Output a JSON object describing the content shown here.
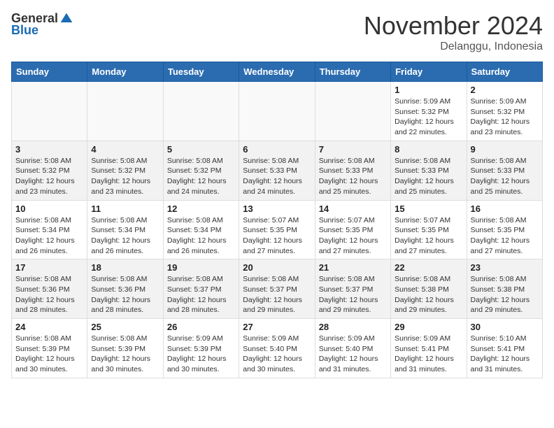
{
  "header": {
    "logo_general": "General",
    "logo_blue": "Blue",
    "month_title": "November 2024",
    "location": "Delanggu, Indonesia"
  },
  "weekdays": [
    "Sunday",
    "Monday",
    "Tuesday",
    "Wednesday",
    "Thursday",
    "Friday",
    "Saturday"
  ],
  "weeks": [
    [
      {
        "day": "",
        "info": ""
      },
      {
        "day": "",
        "info": ""
      },
      {
        "day": "",
        "info": ""
      },
      {
        "day": "",
        "info": ""
      },
      {
        "day": "",
        "info": ""
      },
      {
        "day": "1",
        "info": "Sunrise: 5:09 AM\nSunset: 5:32 PM\nDaylight: 12 hours\nand 22 minutes."
      },
      {
        "day": "2",
        "info": "Sunrise: 5:09 AM\nSunset: 5:32 PM\nDaylight: 12 hours\nand 23 minutes."
      }
    ],
    [
      {
        "day": "3",
        "info": "Sunrise: 5:08 AM\nSunset: 5:32 PM\nDaylight: 12 hours\nand 23 minutes."
      },
      {
        "day": "4",
        "info": "Sunrise: 5:08 AM\nSunset: 5:32 PM\nDaylight: 12 hours\nand 23 minutes."
      },
      {
        "day": "5",
        "info": "Sunrise: 5:08 AM\nSunset: 5:32 PM\nDaylight: 12 hours\nand 24 minutes."
      },
      {
        "day": "6",
        "info": "Sunrise: 5:08 AM\nSunset: 5:33 PM\nDaylight: 12 hours\nand 24 minutes."
      },
      {
        "day": "7",
        "info": "Sunrise: 5:08 AM\nSunset: 5:33 PM\nDaylight: 12 hours\nand 25 minutes."
      },
      {
        "day": "8",
        "info": "Sunrise: 5:08 AM\nSunset: 5:33 PM\nDaylight: 12 hours\nand 25 minutes."
      },
      {
        "day": "9",
        "info": "Sunrise: 5:08 AM\nSunset: 5:33 PM\nDaylight: 12 hours\nand 25 minutes."
      }
    ],
    [
      {
        "day": "10",
        "info": "Sunrise: 5:08 AM\nSunset: 5:34 PM\nDaylight: 12 hours\nand 26 minutes."
      },
      {
        "day": "11",
        "info": "Sunrise: 5:08 AM\nSunset: 5:34 PM\nDaylight: 12 hours\nand 26 minutes."
      },
      {
        "day": "12",
        "info": "Sunrise: 5:08 AM\nSunset: 5:34 PM\nDaylight: 12 hours\nand 26 minutes."
      },
      {
        "day": "13",
        "info": "Sunrise: 5:07 AM\nSunset: 5:35 PM\nDaylight: 12 hours\nand 27 minutes."
      },
      {
        "day": "14",
        "info": "Sunrise: 5:07 AM\nSunset: 5:35 PM\nDaylight: 12 hours\nand 27 minutes."
      },
      {
        "day": "15",
        "info": "Sunrise: 5:07 AM\nSunset: 5:35 PM\nDaylight: 12 hours\nand 27 minutes."
      },
      {
        "day": "16",
        "info": "Sunrise: 5:08 AM\nSunset: 5:35 PM\nDaylight: 12 hours\nand 27 minutes."
      }
    ],
    [
      {
        "day": "17",
        "info": "Sunrise: 5:08 AM\nSunset: 5:36 PM\nDaylight: 12 hours\nand 28 minutes."
      },
      {
        "day": "18",
        "info": "Sunrise: 5:08 AM\nSunset: 5:36 PM\nDaylight: 12 hours\nand 28 minutes."
      },
      {
        "day": "19",
        "info": "Sunrise: 5:08 AM\nSunset: 5:37 PM\nDaylight: 12 hours\nand 28 minutes."
      },
      {
        "day": "20",
        "info": "Sunrise: 5:08 AM\nSunset: 5:37 PM\nDaylight: 12 hours\nand 29 minutes."
      },
      {
        "day": "21",
        "info": "Sunrise: 5:08 AM\nSunset: 5:37 PM\nDaylight: 12 hours\nand 29 minutes."
      },
      {
        "day": "22",
        "info": "Sunrise: 5:08 AM\nSunset: 5:38 PM\nDaylight: 12 hours\nand 29 minutes."
      },
      {
        "day": "23",
        "info": "Sunrise: 5:08 AM\nSunset: 5:38 PM\nDaylight: 12 hours\nand 29 minutes."
      }
    ],
    [
      {
        "day": "24",
        "info": "Sunrise: 5:08 AM\nSunset: 5:39 PM\nDaylight: 12 hours\nand 30 minutes."
      },
      {
        "day": "25",
        "info": "Sunrise: 5:08 AM\nSunset: 5:39 PM\nDaylight: 12 hours\nand 30 minutes."
      },
      {
        "day": "26",
        "info": "Sunrise: 5:09 AM\nSunset: 5:39 PM\nDaylight: 12 hours\nand 30 minutes."
      },
      {
        "day": "27",
        "info": "Sunrise: 5:09 AM\nSunset: 5:40 PM\nDaylight: 12 hours\nand 30 minutes."
      },
      {
        "day": "28",
        "info": "Sunrise: 5:09 AM\nSunset: 5:40 PM\nDaylight: 12 hours\nand 31 minutes."
      },
      {
        "day": "29",
        "info": "Sunrise: 5:09 AM\nSunset: 5:41 PM\nDaylight: 12 hours\nand 31 minutes."
      },
      {
        "day": "30",
        "info": "Sunrise: 5:10 AM\nSunset: 5:41 PM\nDaylight: 12 hours\nand 31 minutes."
      }
    ]
  ]
}
